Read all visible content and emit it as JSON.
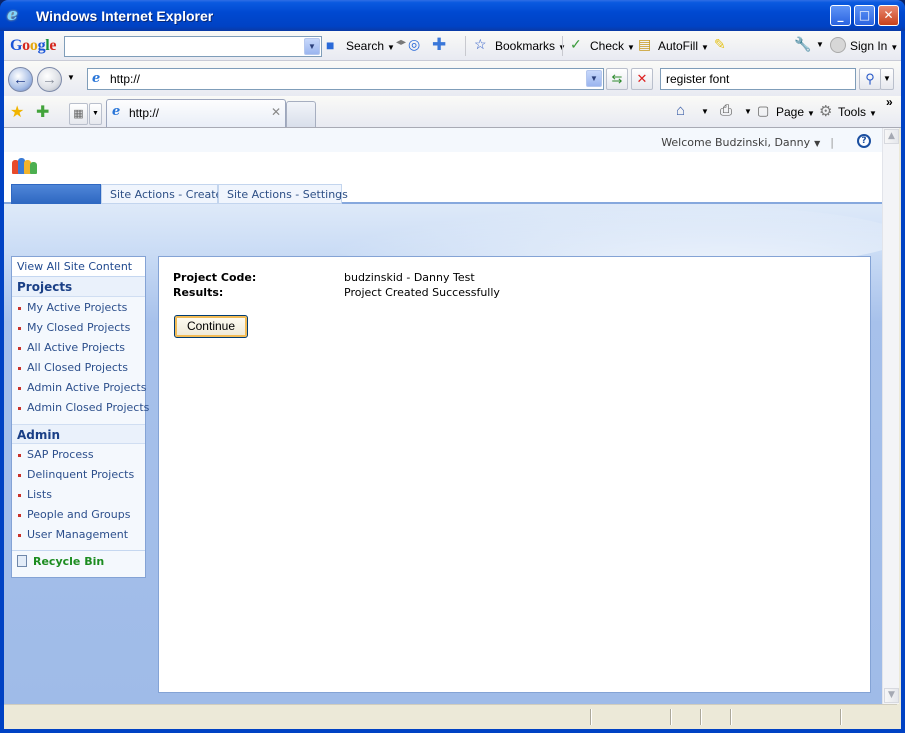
{
  "window": {
    "title": "Windows Internet Explorer",
    "minimize": "_",
    "maximize": "□",
    "close": "✕"
  },
  "google_bar": {
    "logo": [
      "G",
      "o",
      "o",
      "g",
      "l",
      "e"
    ],
    "search_value": "",
    "search_label": "Search",
    "bookmarks_label": "Bookmarks",
    "check_label": "Check",
    "autofill_label": "AutoFill",
    "signin_label": "Sign In"
  },
  "address_bar": {
    "url": "http://",
    "search_value": "register font"
  },
  "tabs_bar": {
    "active_tab_title": "http://",
    "page_label": "Page",
    "tools_label": "Tools",
    "more": "»"
  },
  "site": {
    "welcome": "Welcome Budzinski, Danny",
    "help_icon": "?",
    "top_tabs": [
      {
        "label": ""
      },
      {
        "label": "Site Actions - Create"
      },
      {
        "label": "Site Actions - Settings"
      }
    ],
    "quick_launch": {
      "view_all": "View All Site Content",
      "sections": [
        {
          "heading": "Projects",
          "items": [
            "My Active Projects",
            "My Closed Projects",
            "All Active Projects",
            "All Closed Projects",
            "Admin Active Projects",
            "Admin Closed Projects"
          ]
        },
        {
          "heading": "Admin",
          "items": [
            "SAP Process",
            "Delinquent Projects",
            "Lists",
            "People and Groups",
            "User Management"
          ]
        }
      ],
      "recycle_bin": "Recycle Bin"
    },
    "result": {
      "project_code_label": "Project Code:",
      "project_code_value": "budzinskid - Danny Test",
      "results_label": "Results:",
      "results_value": "Project Created Successfully",
      "continue_label": "Continue"
    }
  },
  "colors": {
    "title_bar": "#0049d1",
    "link_blue": "#2c4f8c",
    "recycle_green": "#1c8c20",
    "bullet_red": "#c9322b"
  }
}
